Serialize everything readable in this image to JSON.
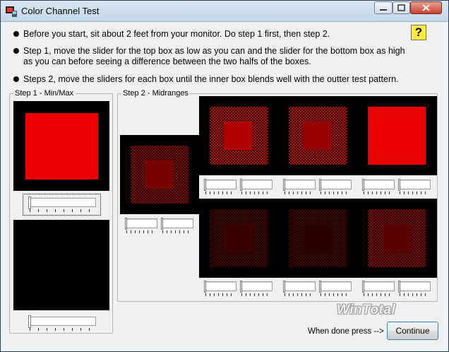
{
  "window": {
    "title": "Color Channel Test",
    "help_label": "?"
  },
  "instructions": [
    "Before you start, sit about 2 feet from your monitor.  Do step 1 first, then step 2.",
    "Step 1, move the slider for the top box as low as you can and the slider for the bottom box as high",
    "as you can before seeing a difference between the two halfs of the boxes.",
    "Steps 2, move the sliders for each box until the inner box blends well with the outter test pattern."
  ],
  "step1": {
    "label": "Step 1 - Min/Max"
  },
  "step2": {
    "label": "Step 2 - Midranges"
  },
  "footer": {
    "hint": "When done press -->",
    "continue_label": "Continue",
    "watermark": "WinTotal"
  },
  "colors": {
    "test_red": "#ee0000",
    "box_black": "#000000"
  }
}
